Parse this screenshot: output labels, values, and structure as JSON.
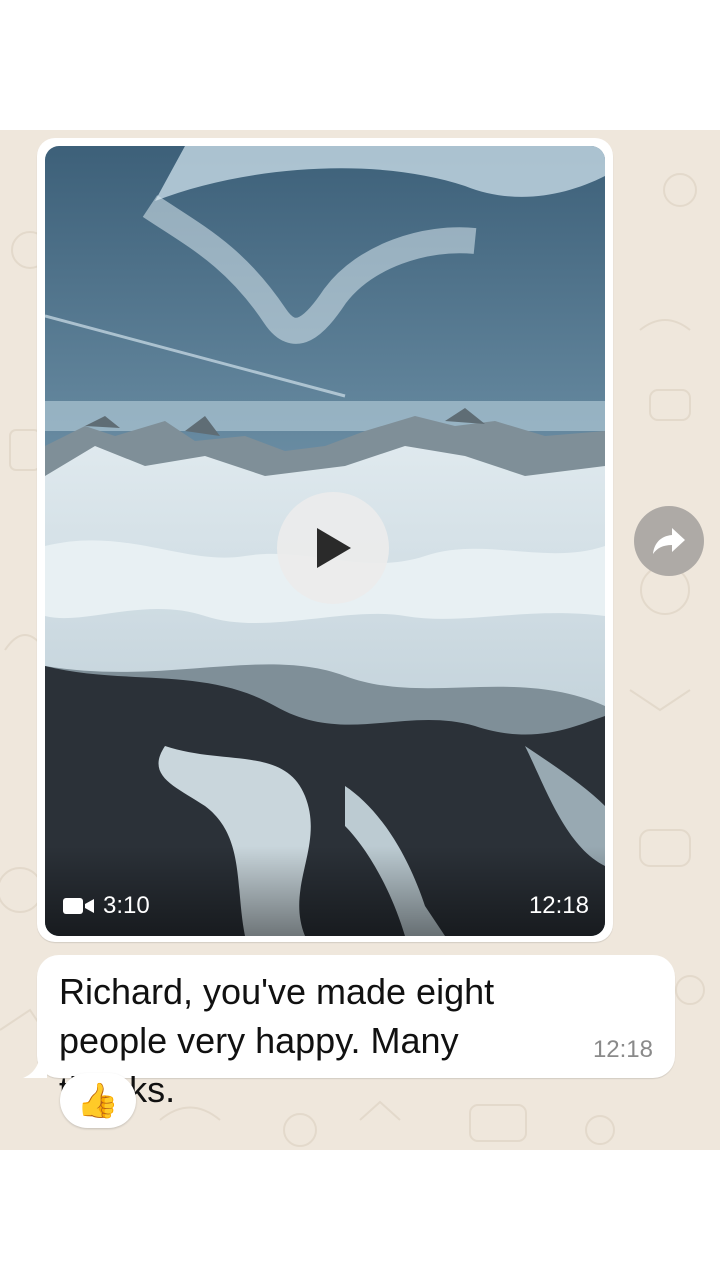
{
  "video_message": {
    "duration": "3:10",
    "time": "12:18"
  },
  "text_message": {
    "text": "Richard, you've made eight people very happy. Many thanks.",
    "time": "12:18",
    "reaction": "👍"
  },
  "icons": {
    "play": "play-icon",
    "forward": "forward-icon",
    "video_camera": "video-camera-icon"
  },
  "colors": {
    "chat_background": "#efe7dc",
    "bubble": "#ffffff",
    "forward_button": "#aeaaa6",
    "timestamp": "#8a8a8a"
  }
}
